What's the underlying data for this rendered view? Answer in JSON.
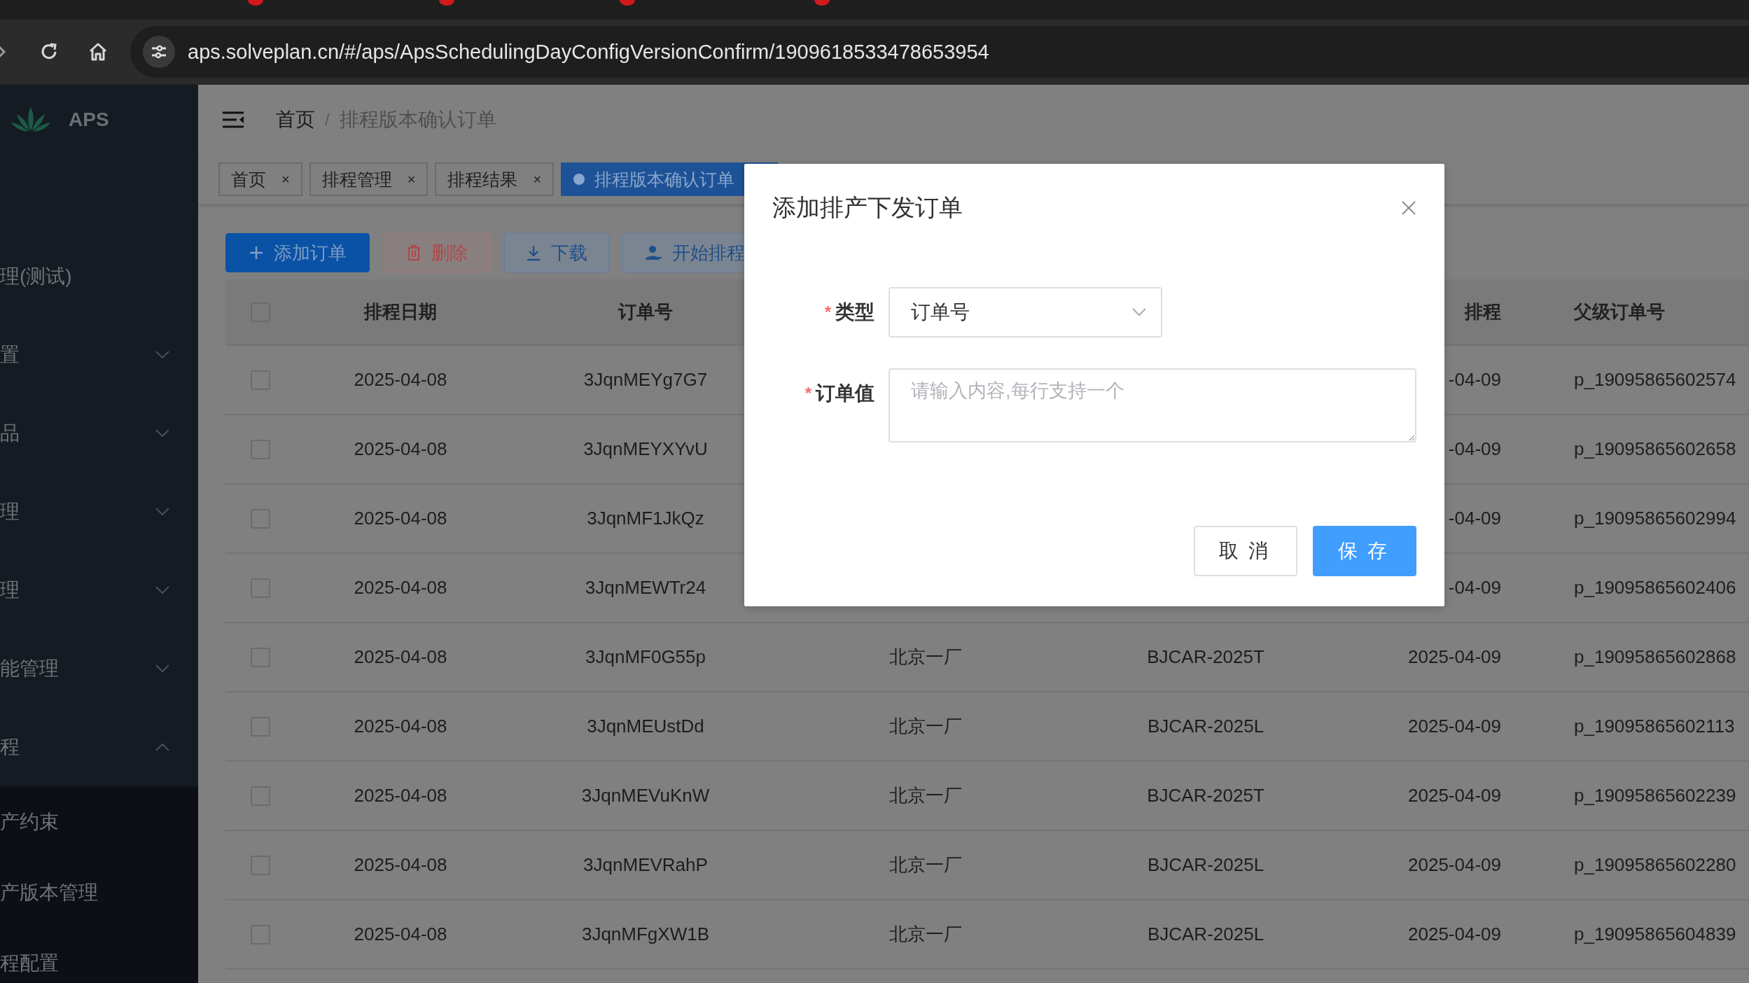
{
  "browser": {
    "url": "aps.solveplan.cn/#/aps/ApsSchedulingDayConfigVersionConfirm/1909618533478653954"
  },
  "sidebar": {
    "logo_text": "APS",
    "items": [
      {
        "label": "理(测试)",
        "kind": "leaf"
      },
      {
        "label": "置",
        "kind": "group",
        "expanded": false
      },
      {
        "label": "品",
        "kind": "group",
        "expanded": false
      },
      {
        "label": "理",
        "kind": "group",
        "expanded": false
      },
      {
        "label": "理",
        "kind": "group",
        "expanded": false
      },
      {
        "label": "能管理",
        "kind": "group",
        "expanded": false
      },
      {
        "label": "程",
        "kind": "group",
        "expanded": true,
        "children": [
          {
            "label": "产约束"
          },
          {
            "label": "产版本管理"
          },
          {
            "label": "程配置"
          }
        ]
      }
    ]
  },
  "breadcrumb": [
    "首页",
    "排程版本确认订单"
  ],
  "breadcrumb_separator": "/",
  "tabs": [
    {
      "label": "首页",
      "selected": false,
      "close_symbol": "×"
    },
    {
      "label": "排程管理",
      "selected": false,
      "close_symbol": "×"
    },
    {
      "label": "排程结果",
      "selected": false,
      "close_symbol": "×"
    },
    {
      "label": "排程版本确认订单",
      "selected": true
    }
  ],
  "toolbar": [
    {
      "label": "添加订单",
      "kind": "add"
    },
    {
      "label": "删除",
      "kind": "delete"
    },
    {
      "label": "下载",
      "kind": "download"
    },
    {
      "label": "开始排程",
      "kind": "schedule"
    }
  ],
  "table": {
    "header": {
      "select_all_checked": false,
      "date": "排程日期",
      "order_no": "订单号",
      "column_5": "排程",
      "parent_order_no": "父级订单号"
    },
    "rows": [
      {
        "checked": false,
        "date": "2025-04-08",
        "order_no": "3JqnMEYg7G7",
        "column_5": "-04-09",
        "parent_order_no": "p_19095865602574"
      },
      {
        "checked": false,
        "date": "2025-04-08",
        "order_no": "3JqnMEYXYvU",
        "column_5": "-04-09",
        "parent_order_no": "p_19095865602658"
      },
      {
        "checked": false,
        "date": "2025-04-08",
        "order_no": "3JqnMF1JkQz",
        "column_5": "-04-09",
        "parent_order_no": "p_19095865602994"
      },
      {
        "checked": false,
        "date": "2025-04-08",
        "order_no": "3JqnMEWTr24",
        "column_5": "-04-09",
        "parent_order_no": "p_19095865602406"
      },
      {
        "checked": false,
        "date": "2025-04-08",
        "order_no": "3JqnMF0G55p",
        "column_3": "北京一厂",
        "column_4": "BJCAR-2025T",
        "column_5": "2025-04-09",
        "parent_order_no": "p_19095865602868"
      },
      {
        "checked": false,
        "date": "2025-04-08",
        "order_no": "3JqnMEUstDd",
        "column_3": "北京一厂",
        "column_4": "BJCAR-2025L",
        "column_5": "2025-04-09",
        "parent_order_no": "p_19095865602113"
      },
      {
        "checked": false,
        "date": "2025-04-08",
        "order_no": "3JqnMEVuKnW",
        "column_3": "北京一厂",
        "column_4": "BJCAR-2025T",
        "column_5": "2025-04-09",
        "parent_order_no": "p_19095865602239"
      },
      {
        "checked": false,
        "date": "2025-04-08",
        "order_no": "3JqnMEVRahP",
        "column_3": "北京一厂",
        "column_4": "BJCAR-2025L",
        "column_5": "2025-04-09",
        "parent_order_no": "p_19095865602280"
      },
      {
        "checked": false,
        "date": "2025-04-08",
        "order_no": "3JqnMFgXW1B",
        "column_3": "北京一厂",
        "column_4": "BJCAR-2025L",
        "column_5": "2025-04-09",
        "parent_order_no": "p_19095865604839"
      }
    ]
  },
  "dialog": {
    "title": "添加排产下发订单",
    "fields": [
      {
        "kind": "select",
        "label": "类型",
        "required_mark": "*",
        "value": "订单号"
      },
      {
        "kind": "textarea",
        "label": "订单值",
        "required_mark": "*",
        "placeholder": "请输入内容,每行支持一个"
      }
    ],
    "buttons": [
      {
        "label": "取消",
        "kind": "default"
      },
      {
        "label": "保存",
        "kind": "primary"
      }
    ]
  }
}
